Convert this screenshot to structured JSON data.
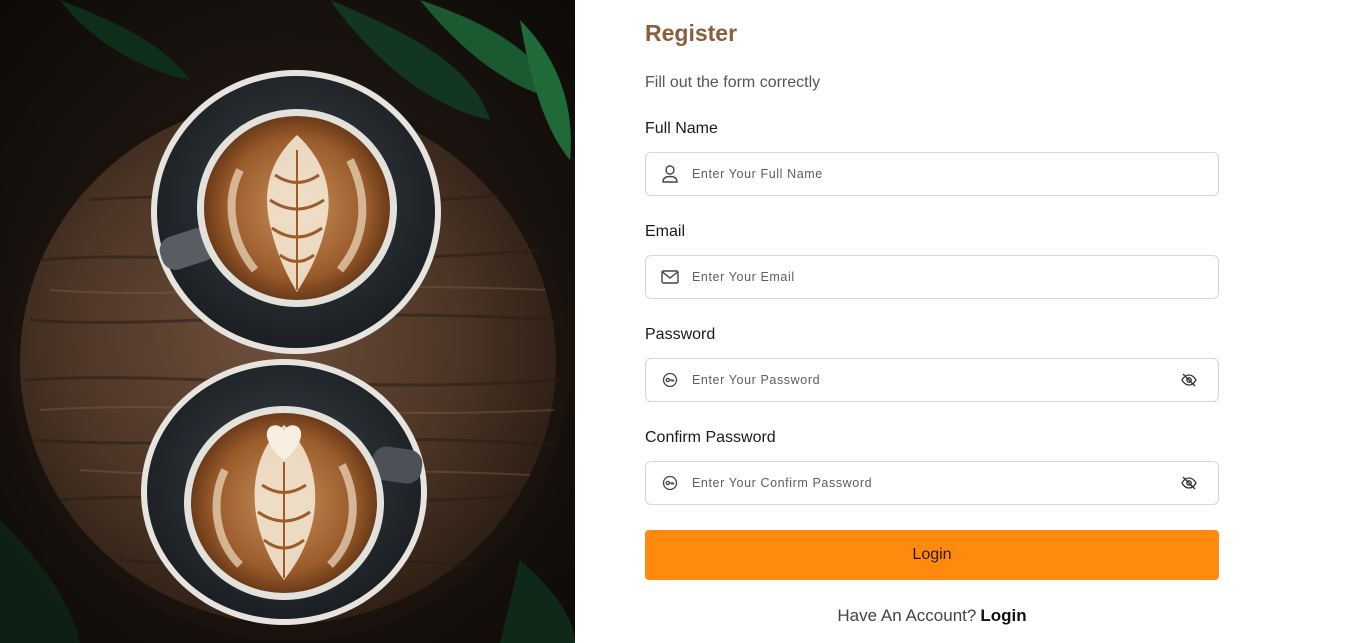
{
  "hero": {
    "image_alt": "Two cups of latte art coffee on a rustic wooden table"
  },
  "form": {
    "title": "Register",
    "subtitle": "Fill out the form correctly",
    "fields": [
      {
        "label": "Full Name",
        "placeholder": "Enter Your Full Name",
        "value": "",
        "icon": "user-icon",
        "type": "text"
      },
      {
        "label": "Email",
        "placeholder": "Enter Your Email",
        "value": "",
        "icon": "mail-icon",
        "type": "email"
      },
      {
        "label": "Password",
        "placeholder": "Enter Your Password",
        "value": "",
        "icon": "key-icon",
        "type": "password",
        "toggle_icon": "eye-slash-icon"
      },
      {
        "label": "Confirm Password",
        "placeholder": "Enter Your Confirm Password",
        "value": "",
        "icon": "key-icon",
        "type": "password",
        "toggle_icon": "eye-slash-icon"
      }
    ],
    "submit_label": "Login",
    "footer_prompt": "Have An Account?",
    "footer_link": "Login"
  },
  "colors": {
    "title": "#8b5e3c",
    "primary_button": "#ff8a0d",
    "input_border": "#d6d6d6"
  }
}
